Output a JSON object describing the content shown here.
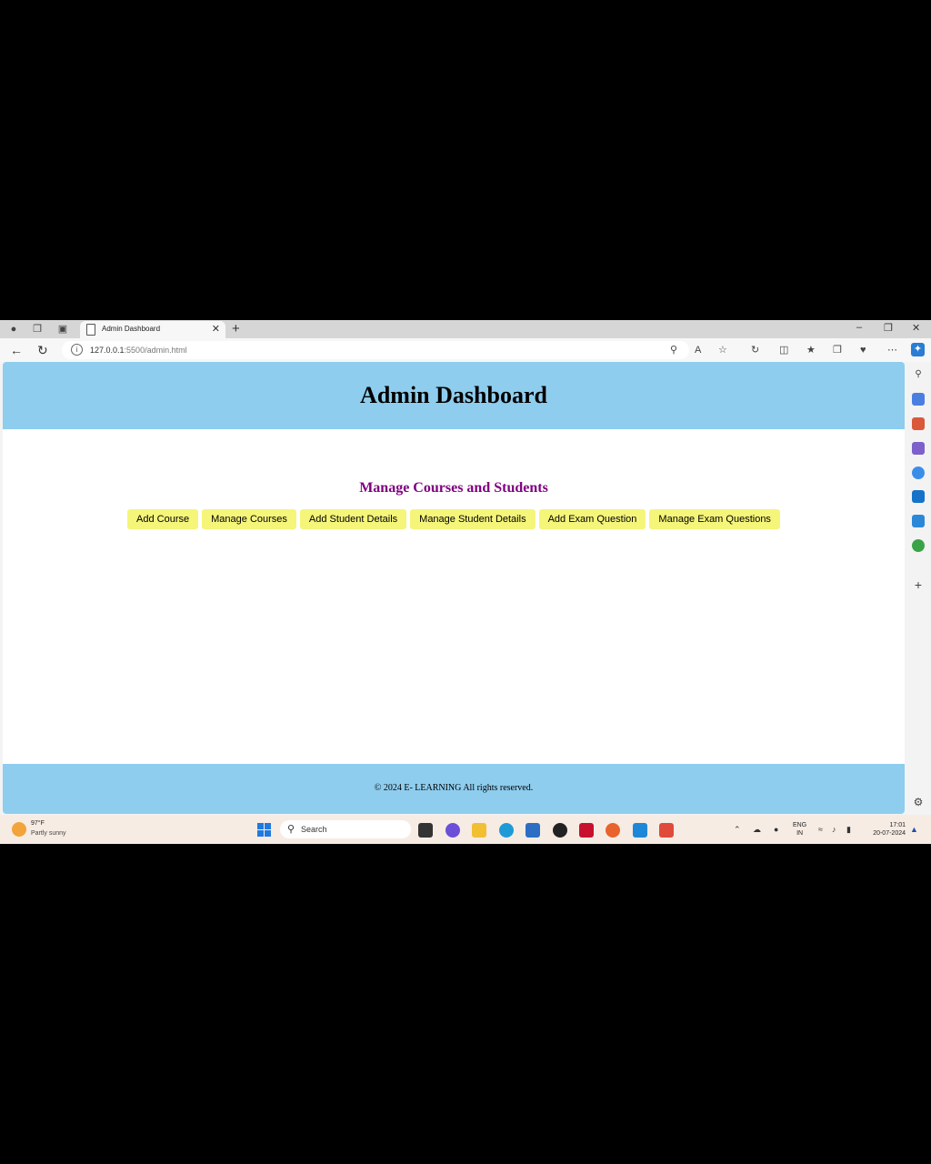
{
  "browser": {
    "tab_title": "Admin Dashboard",
    "url_host": "127.0.0.1",
    "url_rest": ":5500/admin.html"
  },
  "page": {
    "header_title": "Admin Dashboard",
    "section_title": "Manage Courses and Students",
    "buttons": [
      "Add Course",
      "Manage Courses",
      "Add Student Details",
      "Manage Student Details",
      "Add Exam Question",
      "Manage Exam Questions"
    ],
    "footer_text": "© 2024 E- LEARNING All rights reserved.",
    "colors": {
      "header_bg": "#8ecdee",
      "section_title": "#800080",
      "button_bg": "#f5f57a"
    }
  },
  "taskbar": {
    "weather_temp": "97°F",
    "weather_desc": "Partly sunny",
    "search_placeholder": "Search",
    "lang_line1": "ENG",
    "lang_line2": "IN",
    "time": "17:01",
    "date": "20-07-2024"
  }
}
